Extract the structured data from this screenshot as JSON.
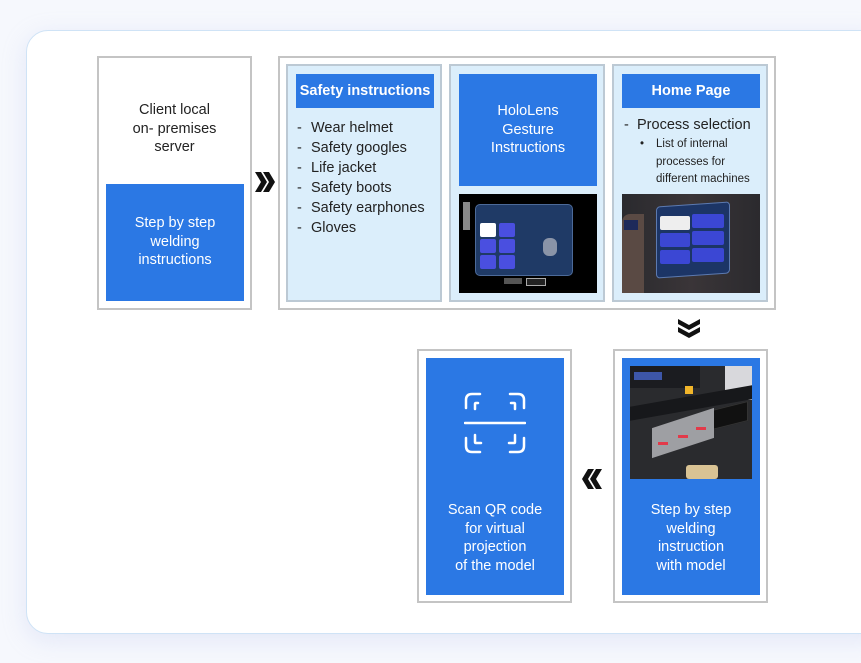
{
  "server": {
    "title_lines": [
      "Client local",
      "on- premises",
      "server"
    ],
    "blue_lines": [
      "Step by step",
      "welding",
      "instructions"
    ]
  },
  "safety": {
    "header": "Safety instructions",
    "items": [
      "Wear helmet",
      "Safety googles",
      "Life jacket",
      "Safety boots",
      "Safety earphones",
      "Gloves"
    ]
  },
  "gesture": {
    "lines": [
      "HoloLens",
      "Gesture",
      "Instructions"
    ],
    "screenshot": "hololens-gestures-screenshot"
  },
  "home": {
    "header": "Home Page",
    "item": "Process selection",
    "sub_lines": [
      "List of internal",
      "processes for",
      "different machines"
    ],
    "screenshot": "process-selection-screenshot"
  },
  "model": {
    "lines": [
      "Step by step",
      "welding",
      "instruction",
      "with model"
    ],
    "screenshot": "welding-model-photo"
  },
  "qr": {
    "icon": "qr-scan-icon",
    "lines": [
      "Scan QR code",
      "for virtual",
      "projection",
      "of the model"
    ]
  },
  "arrows": {
    "right": "double-chevron-right",
    "down": "double-chevron-down",
    "left": "double-chevron-left"
  },
  "colors": {
    "accent": "#2b78e4",
    "panel": "#dbeefb",
    "border": "#c4c4c4"
  }
}
